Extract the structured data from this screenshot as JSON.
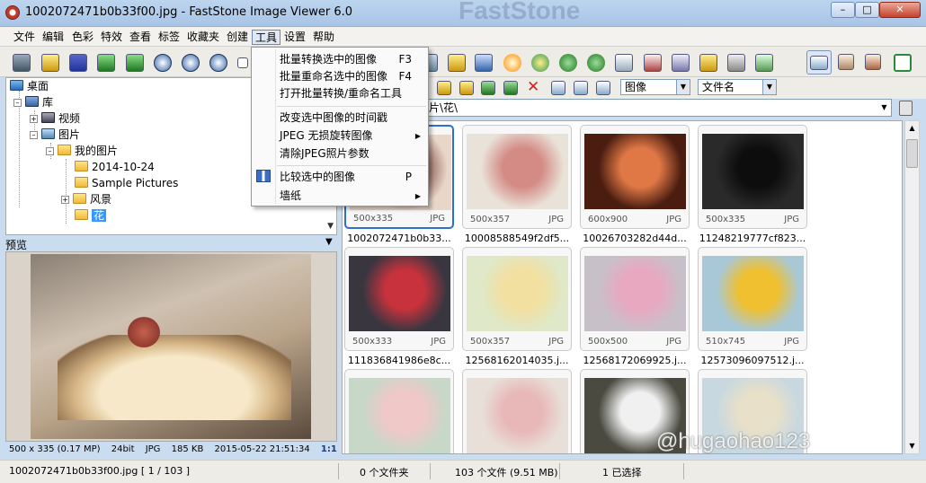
{
  "window": {
    "title": "1002072471b0b33f00.jpg - FastStone Image Viewer 6.0",
    "watermark_app": "FastStone"
  },
  "menubar": [
    "文件",
    "编辑",
    "色彩",
    "特效",
    "查看",
    "标签",
    "收藏夹",
    "创建",
    "工具",
    "设置",
    "帮助"
  ],
  "tools_menu": {
    "items": [
      {
        "label": "批量转换选中的图像",
        "shortcut": "F3"
      },
      {
        "label": "批量重命名选中的图像",
        "shortcut": "F4"
      },
      {
        "label": "打开批量转换/重命名工具",
        "shortcut": ""
      },
      {
        "label": "改变选中图像的时间戳",
        "shortcut": ""
      },
      {
        "label": "JPEG 无损旋转图像",
        "shortcut": ""
      },
      {
        "label": "清除JPEG照片参数",
        "shortcut": ""
      },
      {
        "label": "比较选中的图像",
        "shortcut": "P"
      },
      {
        "label": "墙纸",
        "shortcut": ""
      }
    ]
  },
  "tree": {
    "nodes": [
      {
        "label": "桌面"
      },
      {
        "label": "库"
      },
      {
        "label": "视频"
      },
      {
        "label": "图片"
      },
      {
        "label": "我的图片"
      },
      {
        "label": "2014-10-24"
      },
      {
        "label": "Sample Pictures"
      },
      {
        "label": "风景"
      },
      {
        "label": "花"
      }
    ]
  },
  "preview": {
    "label": "预览",
    "info": {
      "dimensions": "500 x 335 (0.17 MP)",
      "bitdepth": "24bit",
      "format": "JPG",
      "size": "185 KB",
      "datetime": "2015-05-22 21:51:34",
      "zoom": "1:1"
    }
  },
  "right_toolbar": {
    "filter": "图像",
    "sort": "文件名",
    "path": "片\\花\\"
  },
  "thumbnails": [
    {
      "name": "1002072471b0b33...",
      "dim": "500x335",
      "ext": "JPG",
      "c1": "#e8d6c8",
      "c2": "#8a5a50"
    },
    {
      "name": "10008588549f2df5...",
      "dim": "500x357",
      "ext": "JPG",
      "c1": "#e9e2d8",
      "c2": "#d48b86"
    },
    {
      "name": "10026703282d44d...",
      "dim": "600x900",
      "ext": "JPG",
      "c1": "#4a1d10",
      "c2": "#e07846"
    },
    {
      "name": "11248219777cf823...",
      "dim": "500x335",
      "ext": "JPG",
      "c1": "#2a2a2a",
      "c2": "#0d0d0d"
    },
    {
      "name": "111836841986e8c...",
      "dim": "500x333",
      "ext": "JPG",
      "c1": "#3a3640",
      "c2": "#c8323c"
    },
    {
      "name": "12568162014035.j...",
      "dim": "500x357",
      "ext": "JPG",
      "c1": "#dfe8c8",
      "c2": "#f2e0a0"
    },
    {
      "name": "12568172069925.j...",
      "dim": "500x500",
      "ext": "JPG",
      "c1": "#c8c0c8",
      "c2": "#e8a8c0"
    },
    {
      "name": "12573096097512.j...",
      "dim": "510x745",
      "ext": "JPG",
      "c1": "#a8c8d8",
      "c2": "#f0c030"
    },
    {
      "name": "",
      "dim": "",
      "ext": "",
      "c1": "#c8d8c8",
      "c2": "#f0c8c8"
    },
    {
      "name": "",
      "dim": "",
      "ext": "",
      "c1": "#e8e0d8",
      "c2": "#e8b8b8"
    },
    {
      "name": "",
      "dim": "",
      "ext": "",
      "c1": "#4a4a40",
      "c2": "#f0f0f0"
    },
    {
      "name": "",
      "dim": "",
      "ext": "",
      "c1": "#c8d8e0",
      "c2": "#e8e0c8"
    }
  ],
  "statusbar": {
    "file": "1002072471b0b33f00.jpg [ 1 / 103 ]",
    "folders": "0 个文件夹",
    "files": "103 个文件 (9.51 MB)",
    "selected": "1 已选择"
  },
  "overlay_watermark": "@hugaohao123",
  "colors": {
    "selection": "#3399ff",
    "thumb_selected_border": "#2f6fd0",
    "menu_active": "#e0e8f5"
  }
}
